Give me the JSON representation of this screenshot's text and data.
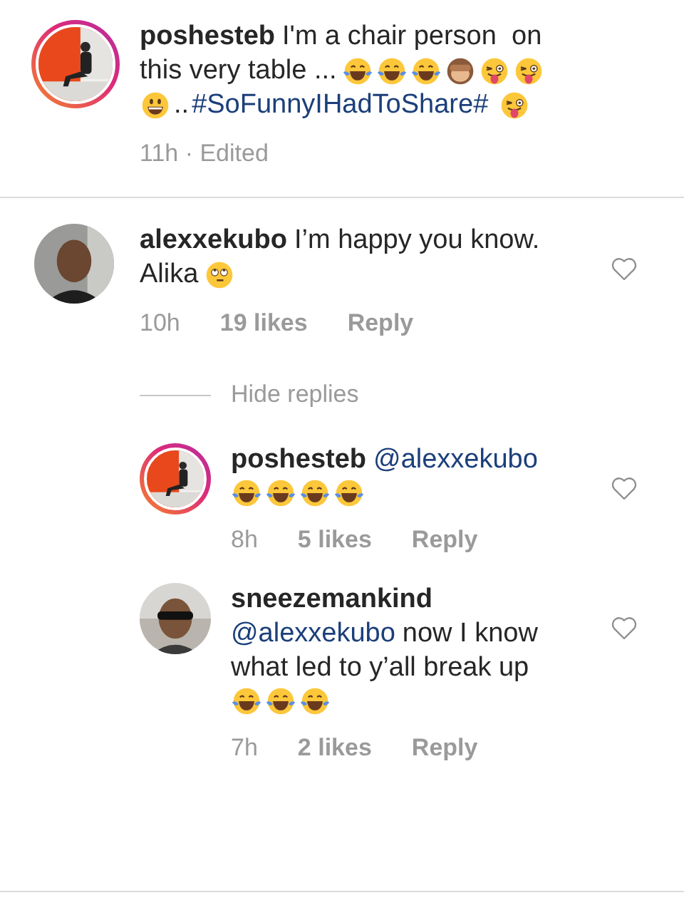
{
  "caption": {
    "avatar": {
      "story_ring": true
    },
    "lines": [
      [
        {
          "kind": "user",
          "text": "poshesteb"
        },
        {
          "kind": "text",
          "text": "I'm a chair person  on"
        }
      ],
      [
        {
          "kind": "text",
          "text": "this very table ..."
        },
        {
          "kind": "laugh"
        },
        {
          "kind": "laugh"
        },
        {
          "kind": "laugh"
        },
        {
          "kind": "monkey"
        },
        {
          "kind": "tongue"
        },
        {
          "kind": "tongue"
        }
      ],
      [
        {
          "kind": "grin"
        },
        {
          "kind": "text",
          "text": ".."
        },
        {
          "kind": "hashtag",
          "text": "#SoFunnyIHadToShare#"
        },
        {
          "kind": "tongue"
        }
      ]
    ],
    "time": "11h · Edited"
  },
  "comments": [
    {
      "avatar": {
        "story_ring": false
      },
      "liked": false,
      "lines": [
        [
          {
            "kind": "user",
            "text": "alexxekubo"
          },
          {
            "kind": "text",
            "text": "I’m happy you know."
          }
        ],
        [
          {
            "kind": "text",
            "text": "Alika"
          },
          {
            "kind": "eyeroll"
          }
        ]
      ],
      "time": "10h",
      "likes": "19 likes",
      "reply": "Reply",
      "toggle": "Hide replies",
      "replies": [
        {
          "avatar": {
            "story_ring": true
          },
          "liked": false,
          "lines": [
            [
              {
                "kind": "user",
                "text": "poshesteb"
              },
              {
                "kind": "mention",
                "text": "@alexxekubo"
              }
            ],
            [
              {
                "kind": "laugh"
              },
              {
                "kind": "laugh"
              },
              {
                "kind": "laugh"
              },
              {
                "kind": "laugh"
              }
            ]
          ],
          "time": "8h",
          "likes": "5 likes",
          "reply": "Reply"
        },
        {
          "avatar": {
            "story_ring": false
          },
          "liked": false,
          "lines": [
            [
              {
                "kind": "user",
                "text": "sneezemankind"
              }
            ],
            [
              {
                "kind": "mention",
                "text": "@alexxekubo"
              },
              {
                "kind": "text",
                "text": "now I know"
              }
            ],
            [
              {
                "kind": "text",
                "text": "what led to y’all break up"
              }
            ],
            [
              {
                "kind": "laugh"
              },
              {
                "kind": "laugh"
              },
              {
                "kind": "laugh"
              }
            ]
          ],
          "time": "7h",
          "likes": "2 likes",
          "reply": "Reply"
        }
      ]
    }
  ]
}
